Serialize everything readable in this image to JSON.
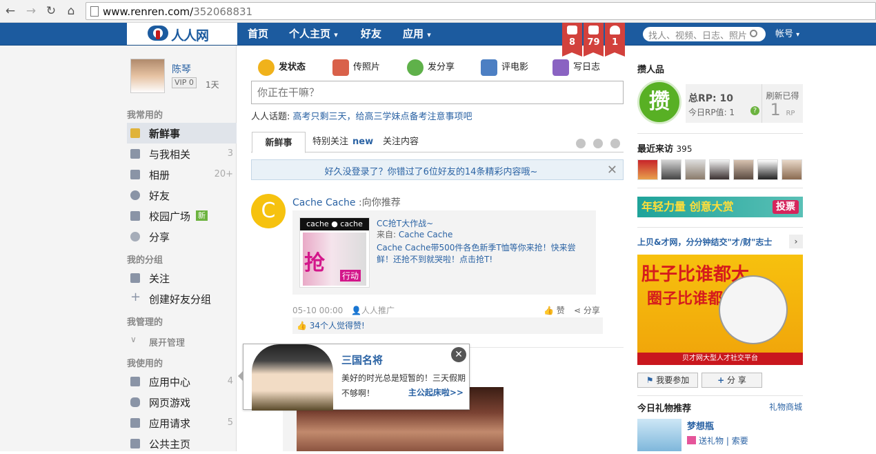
{
  "browser": {
    "url_host": "www.renren.com/",
    "url_path": "352068831"
  },
  "nav": {
    "logo": "人人网",
    "items": [
      "首页",
      "个人主页",
      "好友",
      "应用"
    ],
    "notifications": [
      "8",
      "79",
      "1"
    ],
    "search_placeholder": "找人、视频、日志、照片",
    "account": "帐号"
  },
  "profile": {
    "name": "陈琴",
    "vip": "VIP 0",
    "days": "1天"
  },
  "sidebar": {
    "section_common": "我常用的",
    "common": [
      {
        "label": "新鲜事",
        "count": ""
      },
      {
        "label": "与我相关",
        "count": "3"
      },
      {
        "label": "相册",
        "count": "20+"
      },
      {
        "label": "好友",
        "count": ""
      },
      {
        "label": "校园广场",
        "badge": "新"
      },
      {
        "label": "分享",
        "count": ""
      }
    ],
    "section_groups": "我的分组",
    "groups": [
      {
        "label": "关注"
      },
      {
        "label": "创建好友分组"
      }
    ],
    "section_manage": "我管理的",
    "manage": [
      {
        "label": "展开管理"
      }
    ],
    "section_use": "我使用的",
    "use": [
      {
        "label": "应用中心",
        "count": "4"
      },
      {
        "label": "网页游戏",
        "count": ""
      },
      {
        "label": "应用请求",
        "count": "5"
      },
      {
        "label": "公共主页",
        "count": ""
      }
    ]
  },
  "composer": {
    "tabs": [
      "发状态",
      "传照片",
      "发分享",
      "评电影",
      "写日志"
    ],
    "placeholder": "你正在干嘛？",
    "topic_label": "人人话题:",
    "topic_link": "高考只剩三天，给高三学妹点备考注意事项吧"
  },
  "feed_tabs": {
    "tabs": [
      "新鲜事",
      "特别关注",
      "关注内容"
    ],
    "new_label": "new"
  },
  "notice": "好久没登录了？你错过了6位好友的14条精彩内容哦~",
  "feed_item": {
    "avatar_letter": "C",
    "author": "Cache Cache",
    "action": " :向你推荐",
    "thumb_brand": "cache ● cache",
    "thumb_text": "抢",
    "thumb_go": "行动",
    "share_title": "CC抢T大作战~",
    "share_src_label": "来自:",
    "share_src": "Cache Cache",
    "share_desc": "Cache Cache带500件各色新季T恤等你来抢！快来尝鲜！还抢不到就哭啦！点击抢T!",
    "time": "05-10 00:00",
    "promo": "人人推广",
    "like": "赞",
    "share": "分享",
    "likes_text": "34个人觉得赞!"
  },
  "popup": {
    "title": "三国名将",
    "desc": "美好的时光总是短暂的！三天假期不够啊！",
    "more": "主公起床啦>>",
    "close": "✕"
  },
  "right": {
    "rp_title": "攒人品",
    "rp_char": "攒",
    "rp_total": "总RP: 10",
    "rp_today": "今日RP值: 1",
    "rp_refresh": "刷新已得",
    "rp_value": "1",
    "rp_unit": "RP",
    "visitors_title": "最近来访",
    "visitors_count": "395",
    "banner1": "年轻力量 创意大赏",
    "banner1_vote": "投票",
    "ad_head": "上贝&才网，分分钟结交\"才/财\"志士",
    "ad_line1": "肚子比谁都大,",
    "ad_line2": "圈子比谁都小?",
    "ad_foot": "贝才网大型人才社交平台",
    "btn_join": "我要参加",
    "btn_share": "分 享",
    "gift_title": "今日礼物推荐",
    "gift_mall": "礼物商城",
    "gift_name": "梦想瓶",
    "gift_send": "送礼物",
    "gift_ask": "索要"
  },
  "colors": {
    "nav_blue": "#1c5b9f",
    "link": "#2b63a4",
    "notif_red": "#d2413c"
  }
}
